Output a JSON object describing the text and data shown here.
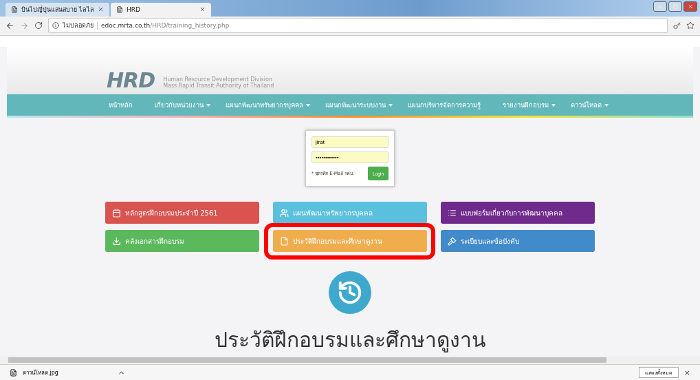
{
  "browser": {
    "tabs": [
      {
        "title": "บินไปญี่ปุ่นแสนสบาย ไลไล",
        "selected": false
      },
      {
        "title": "HRD",
        "selected": true
      }
    ],
    "security": "ไม่ปลอดภัย",
    "url_host": "edoc.mrta.co.th",
    "url_path": "/HRD/training_history.php"
  },
  "header": {
    "logo": "HRD",
    "subtitle_1": "Human Resource Development Division",
    "subtitle_2": "Mass Rapid Transit Authority of Thailand"
  },
  "nav": [
    {
      "label": "หน้าหลัก",
      "dropdown": false
    },
    {
      "label": "เกี่ยวกับหน่วยงาน",
      "dropdown": true
    },
    {
      "label": "แผนกพัฒนาทรัพยากรบุคคล",
      "dropdown": true
    },
    {
      "label": "แผนกพัฒนาระบบงาน",
      "dropdown": true
    },
    {
      "label": "แผนกบริหารจัดการความรู้",
      "dropdown": false
    },
    {
      "label": "รายงานฝึกอบรม",
      "dropdown": true
    },
    {
      "label": "ดาวน์โหลด",
      "dropdown": true
    }
  ],
  "login": {
    "username": "jirat",
    "password": "••••••••••••",
    "note": "* ชุดรหัส E-Mail รฟม.",
    "button": "Login"
  },
  "menu_buttons": [
    {
      "label": "หลักสูตรฝึกอบรมประจำปี 2561",
      "kind": "calendar",
      "color": "#d9534f",
      "selected": false
    },
    {
      "label": "แผนพัฒนาทรัพยากรบุคคล",
      "kind": "users",
      "color": "#5bc0de",
      "selected": false
    },
    {
      "label": "แบบฟอร์มเกี่ยวกับการพัฒนาบุคคล",
      "kind": "form",
      "color": "#6f2a8c",
      "selected": false
    },
    {
      "label": "คลังเอกสารฝึกอบรม",
      "kind": "download",
      "color": "#5cb85c",
      "selected": false
    },
    {
      "label": "ประวัติฝึกอบรมและศึกษาดูงาน",
      "kind": "file",
      "color": "#f0ad4e",
      "selected": true
    },
    {
      "label": "ระเบียบและข้อบังคับ",
      "kind": "gavel",
      "color": "#428bca",
      "selected": false
    }
  ],
  "page_title": "ประวัติฝึกอบรมและศึกษาดูงาน",
  "downloads": {
    "file": "ดาวน์โหลด.jpg",
    "show_all": "แสดงทั้งหมด",
    "close": "×"
  }
}
